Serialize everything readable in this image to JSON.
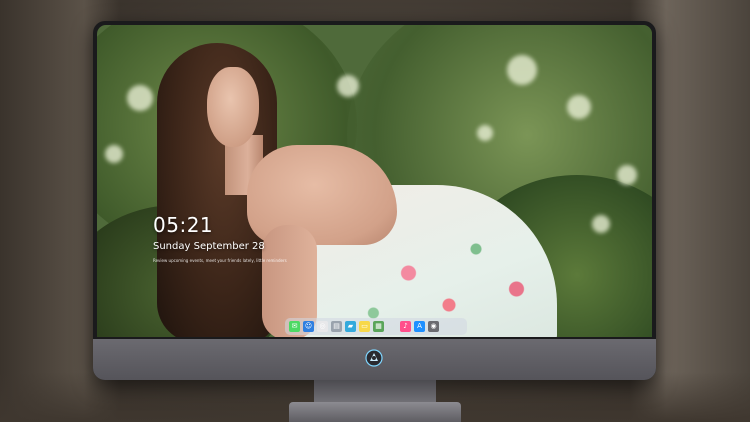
{
  "lockscreen": {
    "time": "05:21",
    "date": "Sunday September  28",
    "notice": "Review upcoming events, meet your friends lately, little reminders"
  },
  "dock": {
    "icons": [
      {
        "name": "messages-icon",
        "color": "#4cd964",
        "glyph": "✉"
      },
      {
        "name": "finder-icon",
        "color": "#2f7fe0",
        "glyph": "☺"
      },
      {
        "name": "safari-icon",
        "color": "#e8e8ea",
        "glyph": "◎"
      },
      {
        "name": "files-icon",
        "color": "#9aa3ad",
        "glyph": "▤"
      },
      {
        "name": "photos-icon",
        "color": "#34aadc",
        "glyph": "▰"
      },
      {
        "name": "notes-icon",
        "color": "#f7d84a",
        "glyph": "▭"
      },
      {
        "name": "gallery-icon",
        "color": "#5aa55a",
        "glyph": "▦"
      },
      {
        "name": "music-icon",
        "color": "#ff4f8b",
        "glyph": "♪"
      },
      {
        "name": "app-store-icon",
        "color": "#1e90ff",
        "glyph": "A"
      },
      {
        "name": "camera-icon",
        "color": "#6b6b70",
        "glyph": "◉"
      }
    ]
  },
  "colors": {
    "bezel": "#1a1a1c",
    "chin": "#605f65",
    "accent_logo": "#7fd6ff"
  }
}
